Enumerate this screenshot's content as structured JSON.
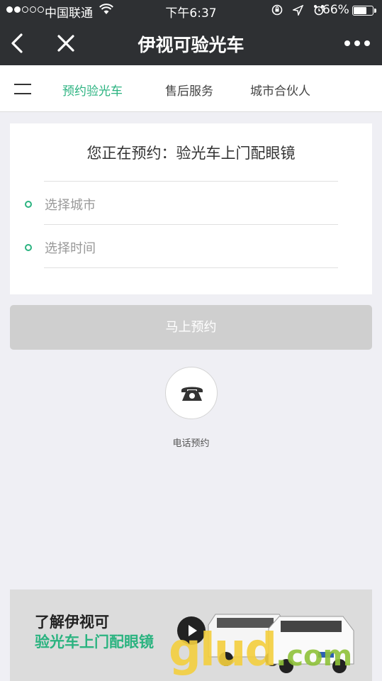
{
  "status_bar": {
    "carrier": "中国联通",
    "time": "下午6:37",
    "battery": "66%"
  },
  "nav": {
    "title": "伊视可验光车"
  },
  "tabs": [
    {
      "label": "预约验光车",
      "active": true
    },
    {
      "label": "售后服务",
      "active": false
    },
    {
      "label": "城市合伙人",
      "active": false
    }
  ],
  "form": {
    "heading": "您正在预约：验光车上门配眼镜",
    "city_placeholder": "选择城市",
    "time_placeholder": "选择时间",
    "submit_label": "马上预约"
  },
  "phone": {
    "label": "电话预约"
  },
  "banner": {
    "line1": "了解伊视可",
    "line2": "验光车上门配眼镜"
  },
  "watermark": {
    "main": "glud",
    "suffix": ".com"
  },
  "colors": {
    "accent": "#2bb380",
    "nav_bg": "#2e3033",
    "page_bg": "#efeff4"
  }
}
